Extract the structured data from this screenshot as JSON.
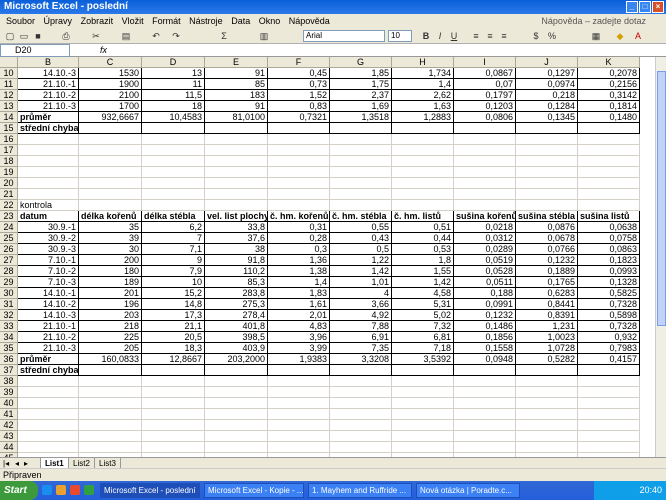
{
  "window": {
    "title": "Microsoft Excel - poslední"
  },
  "menu": {
    "items": [
      "Soubor",
      "Úpravy",
      "Zobrazit",
      "Vložit",
      "Formát",
      "Nástroje",
      "Data",
      "Okno",
      "Nápověda"
    ],
    "help_prompt": "Nápověda – zadejte dotaz"
  },
  "toolbar": {
    "font": "Arial",
    "size": "10",
    "zoom_icon": "Σ"
  },
  "formula": {
    "namebox": "D20",
    "fx": "fx",
    "value": ""
  },
  "columns": [
    "B",
    "C",
    "D",
    "E",
    "F",
    "G",
    "H",
    "I",
    "J",
    "K"
  ],
  "rows_top": [
    {
      "n": "10",
      "cells": [
        "14.10.-3",
        "1530",
        "13",
        "91",
        "0,45",
        "1,85",
        "1,734",
        "0,0867",
        "0,1297",
        "0,2078"
      ]
    },
    {
      "n": "11",
      "cells": [
        "21.10.-1",
        "1900",
        "11",
        "85",
        "0,73",
        "1,75",
        "1,4",
        "0,07",
        "0,0974",
        "0,2156"
      ]
    },
    {
      "n": "12",
      "cells": [
        "21.10.-2",
        "2100",
        "11,5",
        "183",
        "1,52",
        "2,37",
        "2,62",
        "0,1797",
        "0,218",
        "0,3142"
      ]
    },
    {
      "n": "13",
      "cells": [
        "21.10.-3",
        "1700",
        "18",
        "91",
        "0,83",
        "1,69",
        "1,63",
        "0,1203",
        "0,1284",
        "0,1814"
      ]
    },
    {
      "n": "14",
      "cells": [
        "průměr",
        "932,6667",
        "10,4583",
        "81,0100",
        "0,7321",
        "1,3518",
        "1,2883",
        "0,0806",
        "0,1345",
        "0,1480"
      ]
    },
    {
      "n": "15",
      "cells": [
        "střední chyba",
        "",
        "",
        "",
        "",
        "",
        "",
        "",
        "",
        ""
      ]
    }
  ],
  "empty_rows": [
    "16",
    "17",
    "18",
    "19",
    "20",
    "21"
  ],
  "label_row": {
    "n": "22",
    "text": "kontrola"
  },
  "table2_header": {
    "n": "23",
    "cells": [
      "datum",
      "délka kořenů",
      "délka stébla",
      "vel. list plochy",
      "č. hm. kořenů",
      "č. hm. stébla",
      "č. hm. listů",
      "sušina kořenů",
      "sušina stébla",
      "sušina listů"
    ]
  },
  "rows_bottom": [
    {
      "n": "24",
      "cells": [
        "30.9.-1",
        "35",
        "6,2",
        "33,8",
        "0,31",
        "0,55",
        "0,51",
        "0,0218",
        "0,0876",
        "0,0638"
      ]
    },
    {
      "n": "25",
      "cells": [
        "30.9.-2",
        "39",
        "7",
        "37,6",
        "0,28",
        "0,43",
        "0,44",
        "0,0312",
        "0,0678",
        "0,0758"
      ]
    },
    {
      "n": "26",
      "cells": [
        "30.9.-3",
        "30",
        "7,1",
        "38",
        "0,3",
        "0,5",
        "0,53",
        "0,0289",
        "0,0766",
        "0,0863"
      ]
    },
    {
      "n": "27",
      "cells": [
        "7.10.-1",
        "200",
        "9",
        "91,8",
        "1,36",
        "1,22",
        "1,8",
        "0,0519",
        "0,1232",
        "0,1823"
      ]
    },
    {
      "n": "28",
      "cells": [
        "7.10.-2",
        "180",
        "7,9",
        "110,2",
        "1,38",
        "1,42",
        "1,55",
        "0,0528",
        "0,1889",
        "0,0993"
      ]
    },
    {
      "n": "29",
      "cells": [
        "7.10.-3",
        "189",
        "10",
        "85,3",
        "1,4",
        "1,01",
        "1,42",
        "0,0511",
        "0,1765",
        "0,1328"
      ]
    },
    {
      "n": "30",
      "cells": [
        "14.10.-1",
        "201",
        "15,2",
        "283,8",
        "1,83",
        "4",
        "4,58",
        "0,188",
        "0,6283",
        "0,5825"
      ]
    },
    {
      "n": "31",
      "cells": [
        "14.10.-2",
        "196",
        "14,8",
        "275,3",
        "1,61",
        "3,66",
        "5,31",
        "0,0991",
        "0,8441",
        "0,7328"
      ]
    },
    {
      "n": "32",
      "cells": [
        "14.10.-3",
        "203",
        "17,3",
        "278,4",
        "2,01",
        "4,92",
        "5,02",
        "0,1232",
        "0,8391",
        "0,5898"
      ]
    },
    {
      "n": "33",
      "cells": [
        "21.10.-1",
        "218",
        "21,1",
        "401,8",
        "4,83",
        "7,88",
        "7,32",
        "0,1486",
        "1,231",
        "0,7328"
      ]
    },
    {
      "n": "34",
      "cells": [
        "21.10.-2",
        "225",
        "20,5",
        "398,5",
        "3,96",
        "6,91",
        "6,81",
        "0,1856",
        "1,0023",
        "0,932"
      ]
    },
    {
      "n": "35",
      "cells": [
        "21.10.-3",
        "205",
        "18,3",
        "403,9",
        "3,99",
        "7,35",
        "7,18",
        "0,1558",
        "1,0728",
        "0,7983"
      ]
    },
    {
      "n": "36",
      "cells": [
        "průměr",
        "160,0833",
        "12,8667",
        "203,2000",
        "1,9383",
        "3,3208",
        "3,5392",
        "0,0948",
        "0,5282",
        "0,4157"
      ]
    },
    {
      "n": "37",
      "cells": [
        "střední chyba",
        "",
        "",
        "",
        "",
        "",
        "",
        "",
        "",
        ""
      ]
    }
  ],
  "trailing_rows": [
    "38",
    "39",
    "40",
    "41",
    "42",
    "43",
    "44",
    "45",
    "46"
  ],
  "sheets": [
    "List1",
    "List2",
    "List3"
  ],
  "status": "Připraven",
  "taskbar": {
    "start": "Start",
    "tasks": [
      "Microsoft Excel - poslední",
      "Microsoft Excel - Kopie - ...",
      "1. Mayhem and Ruffride ...",
      "Nová otázka | Poradte.c..."
    ],
    "time": "20:40"
  }
}
